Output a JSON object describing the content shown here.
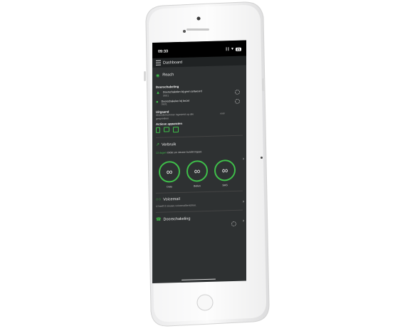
{
  "status": {
    "time": "09:33",
    "signal": "∥∥",
    "wifi": "▼",
    "battery": "21"
  },
  "topbar": {
    "title": "Dashboard"
  },
  "reach": {
    "label": "Reach"
  },
  "forwarding": {
    "title": "Doorschakeling",
    "items": [
      {
        "label": "Doorschakelen bij geen antwoord",
        "number": "0601"
      },
      {
        "label": "Doorschakelen bij bezet",
        "number": "0601"
      }
    ]
  },
  "outgoing": {
    "title": "Uitgaand",
    "text": "Afzendernummer ingesteld op alle gesprekken",
    "value": "voor"
  },
  "devices": {
    "title": "Actieve apparaten"
  },
  "usage": {
    "title": "Verbruik",
    "highlight": "13 dagen",
    "text": "totdat uw nieuwe bundel ingaat.",
    "items": [
      {
        "symbol": "∞",
        "label": "Data"
      },
      {
        "symbol": "∞",
        "label": "Bellen"
      },
      {
        "symbol": "∞",
        "label": "SMS"
      }
    ]
  },
  "voicemail": {
    "title": "Voicemail",
    "text": "U heeft 0 nieuwe voicemailberichten."
  },
  "forwarding2": {
    "title": "Doorschakeling"
  },
  "colors": {
    "accent": "#3fbf4a",
    "screen_bg": "#2e3132",
    "phone_body": "#f4f4f4"
  }
}
